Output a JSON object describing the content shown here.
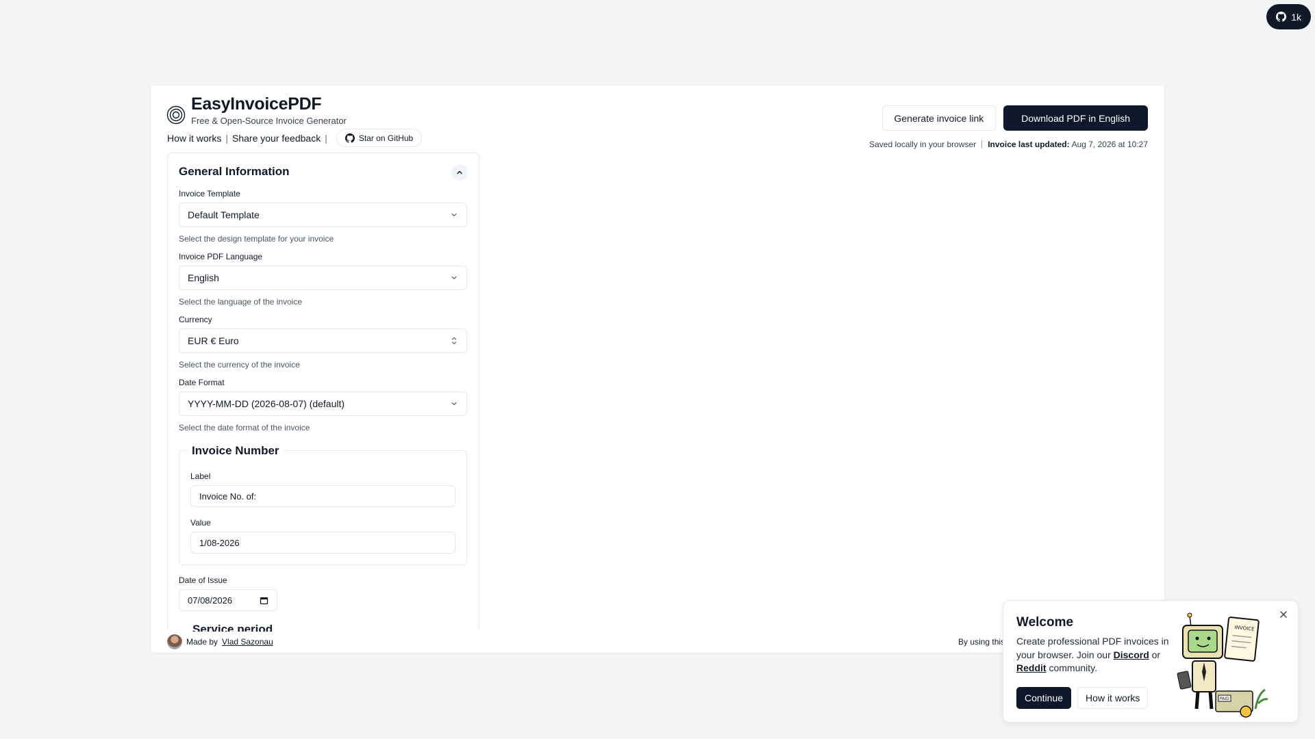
{
  "github_badge": {
    "icon": "github-icon",
    "count": "1k"
  },
  "header": {
    "brand": "EasyInvoicePDF",
    "subtitle": "Free & Open-Source Invoice Generator",
    "nav": [
      "How it works",
      "Share your feedback"
    ],
    "star_label": "Star on GitHub",
    "generate_link_label": "Generate invoice link",
    "download_label": "Download PDF in English",
    "saved_text": "Saved locally in your browser",
    "last_updated_label": "Invoice last updated:",
    "last_updated_value": "Aug 7, 2026 at 10:27"
  },
  "general": {
    "title": "General Information",
    "template": {
      "label": "Invoice Template",
      "value": "Default Template",
      "hint": "Select the design template for your invoice"
    },
    "language": {
      "label": "Invoice PDF Language",
      "value": "English",
      "hint": "Select the language of the invoice"
    },
    "currency": {
      "label": "Currency",
      "value": "EUR € Euro",
      "hint": "Select the currency of the invoice"
    },
    "date_format": {
      "label": "Date Format",
      "value": "YYYY-MM-DD (2026-08-07) (default)",
      "hint": "Select the date format of the invoice"
    },
    "invoice_number": {
      "title": "Invoice Number",
      "label_label": "Label",
      "label_value": "Invoice No. of:",
      "value_label": "Value",
      "value_value": "1/08-2026"
    },
    "date_of_issue": {
      "label": "Date of Issue",
      "value": "07/08/2026"
    },
    "service_period_title": "Service period"
  },
  "footer": {
    "made_by": "Made by",
    "author": "Vlad Sazonau",
    "right_text": "By using this"
  },
  "welcome": {
    "title": "Welcome",
    "msg_1": "Create professional PDF invoices in your browser. Join our ",
    "discord": "Discord",
    "msg_or": " or ",
    "reddit": "Reddit",
    "msg_2": " community.",
    "continue_label": "Continue",
    "how_label": "How it works",
    "mascot_invoice_text": "INVOICE",
    "mascot_paid_text": "PAID"
  }
}
